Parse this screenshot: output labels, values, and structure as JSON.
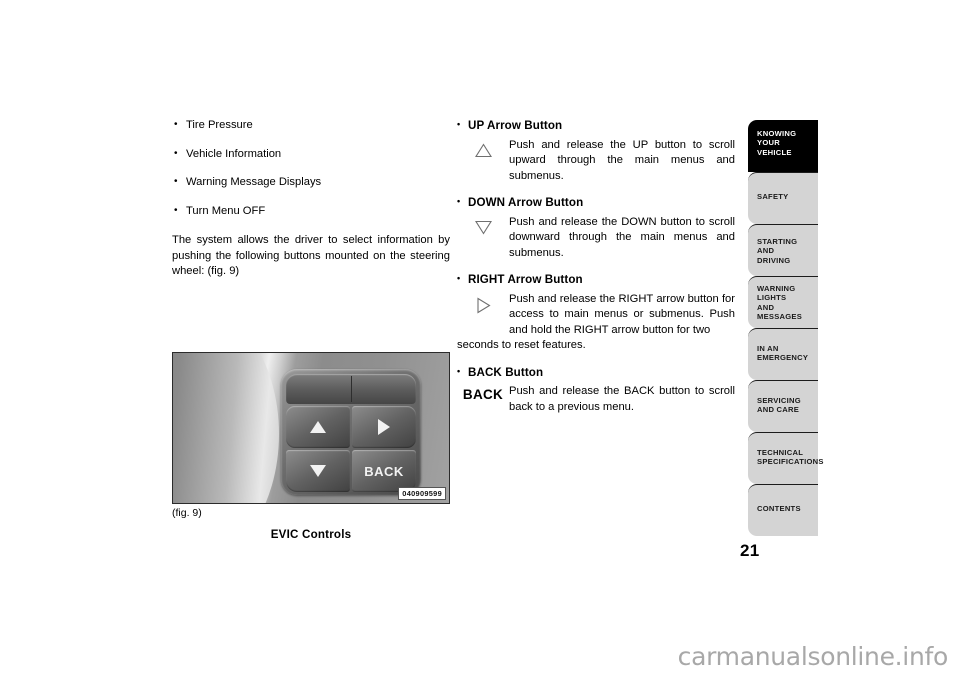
{
  "document": {
    "page_number": "21",
    "watermark": "carmanualsonline.info"
  },
  "left_column": {
    "bullets": [
      "Tire Pressure",
      "Vehicle Information",
      "Warning Message Displays",
      "Turn Menu OFF"
    ],
    "paragraph": "The system allows the driver to select information by pushing the following buttons mounted on the steering wheel:  (fig. 9)"
  },
  "right_column": {
    "buttons": [
      {
        "heading": "UP Arrow Button",
        "icon": "triangle-up-outline-icon",
        "description": "Push and release the UP button to scroll upward through the main menus and submenus."
      },
      {
        "heading": "DOWN Arrow Button",
        "icon": "triangle-down-outline-icon",
        "description": "Push and release the DOWN button to scroll downward through the main menus and submenus."
      },
      {
        "heading": "RIGHT Arrow Button",
        "icon": "triangle-right-outline-icon",
        "description": "Push and release the RIGHT arrow button for access to main menus or submenus. Push and hold the RIGHT arrow button for two",
        "overflow": "seconds to reset features."
      },
      {
        "heading": "BACK Button",
        "icon": "back-label-icon",
        "icon_label": "BACK",
        "description": "Push and release the BACK button to scroll back to a previous menu."
      }
    ]
  },
  "figure": {
    "number": "(fig. 9)",
    "caption": "EVIC Controls",
    "image_code": "040909599",
    "keys": {
      "up": "up-arrow-key",
      "right": "right-arrow-key",
      "down": "down-arrow-key",
      "back": "BACK"
    }
  },
  "sidebar": {
    "tabs": [
      {
        "lines": [
          "KNOWING",
          "YOUR",
          "VEHICLE"
        ],
        "active": true
      },
      {
        "lines": [
          "SAFETY"
        ],
        "active": false
      },
      {
        "lines": [
          "STARTING",
          "AND",
          "DRIVING"
        ],
        "active": false
      },
      {
        "lines": [
          "WARNING",
          "LIGHTS",
          "AND",
          "MESSAGES"
        ],
        "active": false
      },
      {
        "lines": [
          "IN AN",
          "EMERGENCY"
        ],
        "active": false
      },
      {
        "lines": [
          "SERVICING",
          "AND CARE"
        ],
        "active": false
      },
      {
        "lines": [
          "TECHNICAL",
          "SPECIFICATIONS"
        ],
        "active": false
      },
      {
        "lines": [
          "CONTENTS"
        ],
        "active": false
      }
    ]
  }
}
